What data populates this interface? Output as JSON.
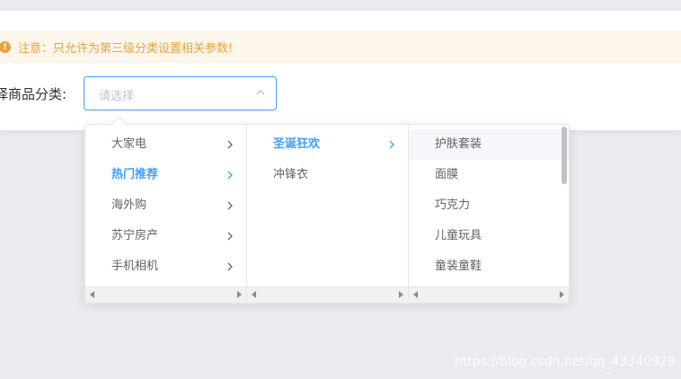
{
  "alert": {
    "icon": "warning-icon",
    "text": "注意：只允许为第三级分类设置相关参数!"
  },
  "form": {
    "label": "择商品分类:",
    "placeholder": "请选择"
  },
  "cascader": {
    "level1": [
      {
        "label": "大家电"
      },
      {
        "label": "热门推荐",
        "active": true
      },
      {
        "label": "海外购"
      },
      {
        "label": "苏宁房产"
      },
      {
        "label": "手机相机"
      }
    ],
    "level2": [
      {
        "label": "圣诞狂欢",
        "active": true
      },
      {
        "label": "冲锋衣"
      }
    ],
    "level3": [
      {
        "label": "护肤套装"
      },
      {
        "label": "面膜"
      },
      {
        "label": "巧克力"
      },
      {
        "label": "儿童玩具"
      },
      {
        "label": "童装童鞋"
      }
    ]
  },
  "colors": {
    "accent": "#409eff",
    "warning": "#e6a23c",
    "warning_bg": "#fdf6ec"
  },
  "watermark": "https://blog.csdn.net/qq_43340929"
}
